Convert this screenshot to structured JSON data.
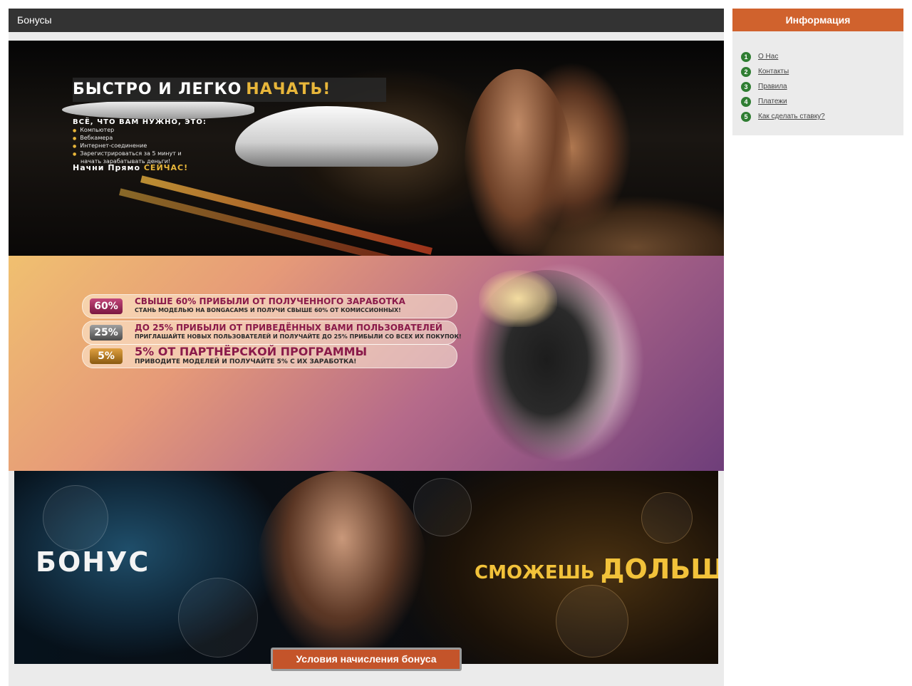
{
  "main": {
    "title": "Бонусы",
    "bonus_button_label": "Условия начисления бонуса"
  },
  "banners": {
    "banner1": {
      "headline_white": "БЫСТРО И ЛЕГКО",
      "headline_gold": "НАЧАТЬ!",
      "subhead": "ВСЁ, ЧТО ВАМ НУЖНО, ЭТО:",
      "list": [
        "Компьютер",
        "Вебкамера",
        "Интернет-соединение",
        "Зарегистрироваться за 5 минут и",
        "начать зарабатывать деньги!"
      ],
      "cta_white": "Начни Прямо",
      "cta_gold": "СЕЙЧАС!"
    },
    "banner2": {
      "rows": [
        {
          "badge": "60%",
          "title": "СВЫШЕ 60% ПРИБЫЛИ ОТ ПОЛУЧЕННОГО ЗАРАБОТКА",
          "desc": "СТАНЬ МОДЕЛЬЮ НА BONGACAMS И ПОЛУЧИ СВЫШЕ 60% ОТ КОМИССИОННЫХ!"
        },
        {
          "badge": "25%",
          "title": "ДО 25% ПРИБЫЛИ ОТ ПРИВЕДЁННЫХ ВАМИ ПОЛЬЗОВАТЕЛЕЙ",
          "desc": "ПРИГЛАШАЙТЕ НОВЫХ ПОЛЬЗОВАТЕЛЕЙ И ПОЛУЧАЙТЕ ДО 25% ПРИБЫЛИ СО ВСЕХ ИХ ПОКУПОК!"
        },
        {
          "badge": "5%",
          "title": "5% ОТ ПАРТНЁРСКОЙ ПРОГРАММЫ",
          "desc": "ПРИВОДИТЕ МОДЕЛЕЙ И ПОЛУЧАЙТЕ 5% С ИХ ЗАРАБОТКА!"
        }
      ]
    },
    "banner3": {
      "left_text": "БОНУС",
      "right_small": "СМОЖЕШЬ",
      "right_big": "ДОЛЬШЕ"
    }
  },
  "sidebar": {
    "title": "Информация",
    "items": [
      {
        "num": "1",
        "label": "О Нас"
      },
      {
        "num": "2",
        "label": "Контакты"
      },
      {
        "num": "3",
        "label": "Правила"
      },
      {
        "num": "4",
        "label": "Платежи"
      },
      {
        "num": "5",
        "label": "Как сделать ставку?"
      }
    ]
  },
  "colors": {
    "header_dark": "#333333",
    "sidebar_accent": "#d0622d",
    "number_badge": "#2f7d32",
    "button": "#c4542a"
  }
}
